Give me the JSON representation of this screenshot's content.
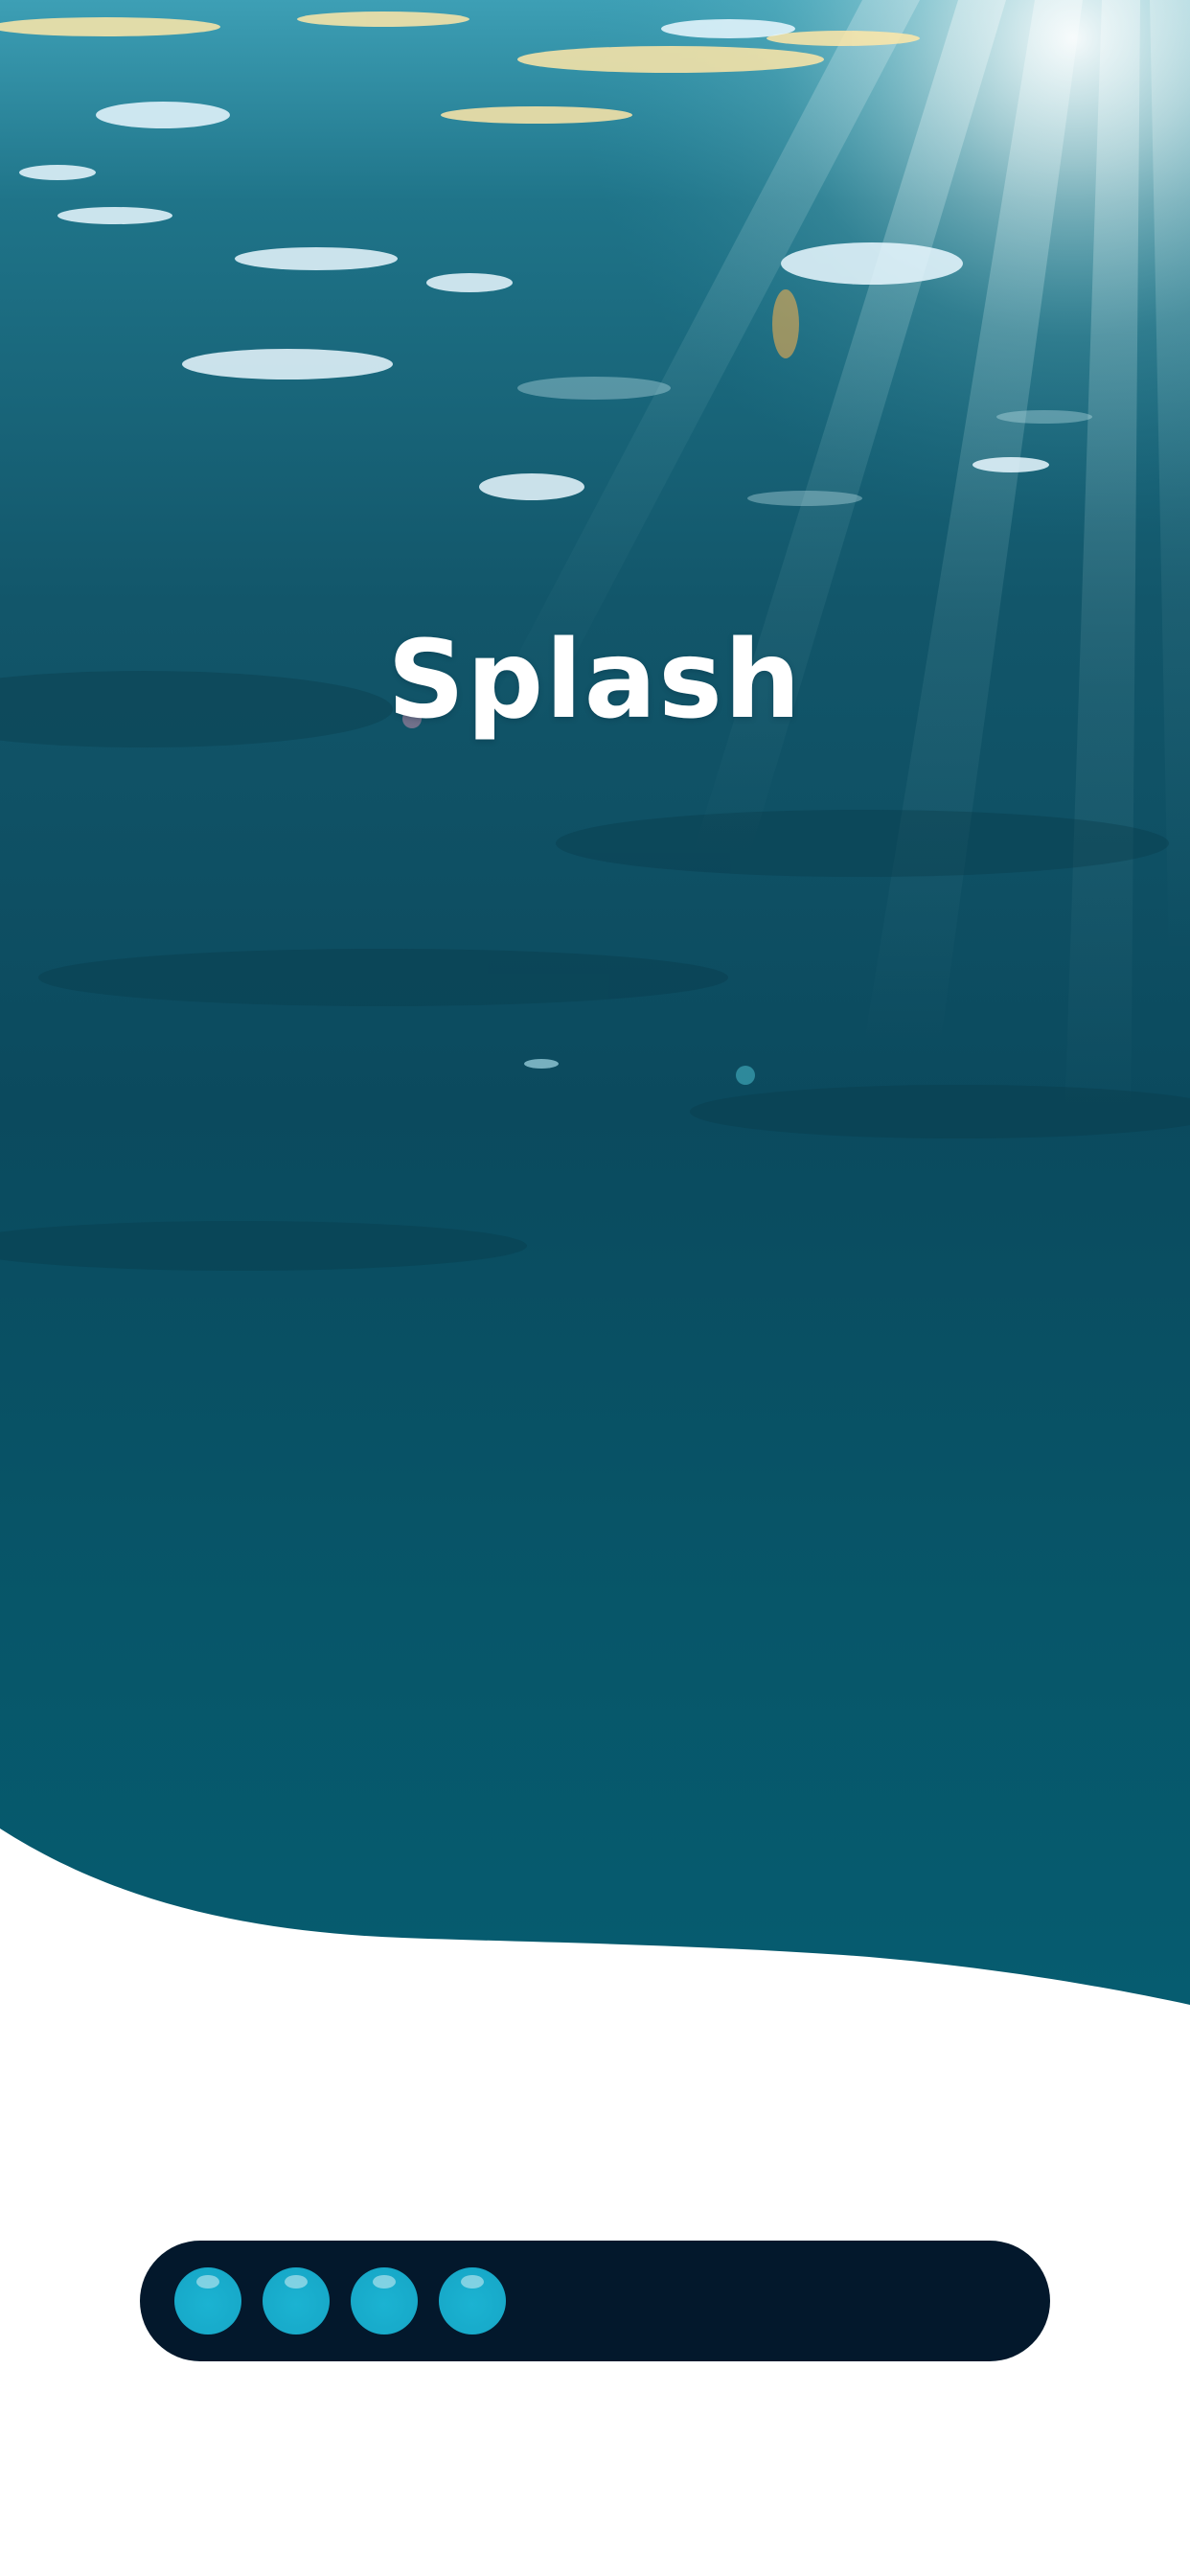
{
  "app": {
    "title": "Splash"
  },
  "loader": {
    "progress_filled_dots": 4,
    "dot_color": "#18add0",
    "track_color": "#03182c"
  },
  "colors": {
    "water_top": "#2a8ea3",
    "water_mid": "#0e4f63",
    "water_bottom": "#065b6e",
    "background": "#ffffff"
  },
  "icons": {
    "loader_dot": "bubble-icon"
  }
}
